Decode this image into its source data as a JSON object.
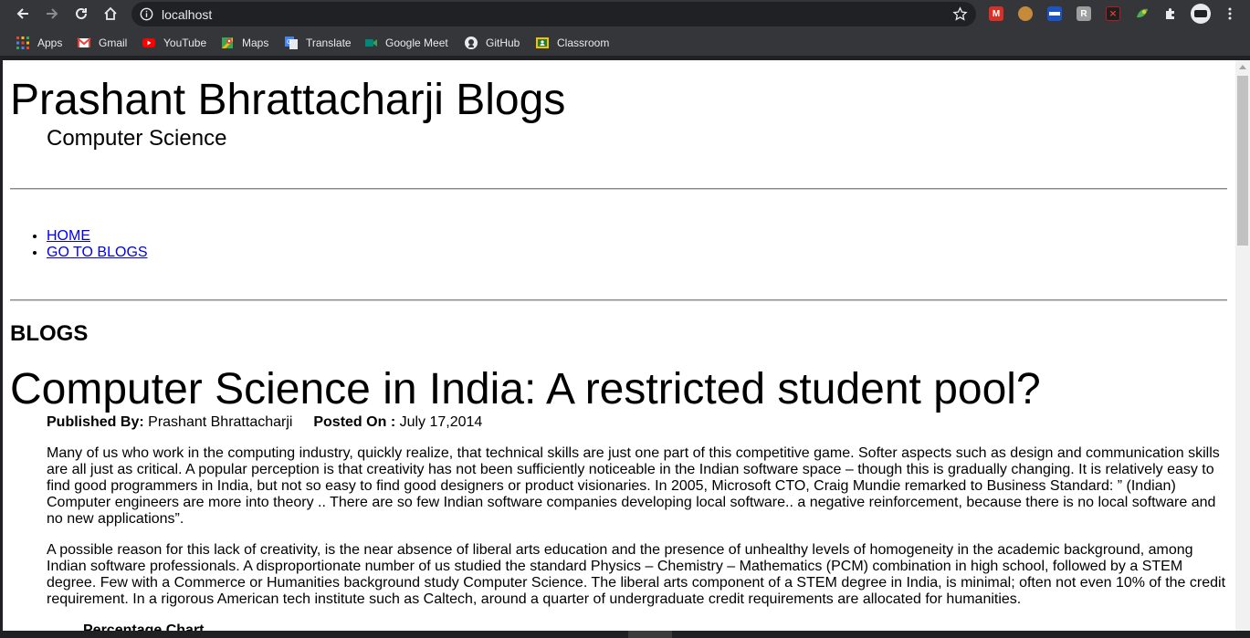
{
  "browser": {
    "url": "localhost",
    "bookmarks": [
      {
        "label": "Apps",
        "icon": "apps-grid-icon"
      },
      {
        "label": "Gmail",
        "icon": "gmail-icon"
      },
      {
        "label": "YouTube",
        "icon": "youtube-icon"
      },
      {
        "label": "Maps",
        "icon": "maps-icon"
      },
      {
        "label": "Translate",
        "icon": "translate-icon"
      },
      {
        "label": "Google Meet",
        "icon": "meet-icon"
      },
      {
        "label": "GitHub",
        "icon": "github-icon"
      },
      {
        "label": "Classroom",
        "icon": "classroom-icon"
      }
    ],
    "extensions": [
      "m-icon",
      "cookie-icon",
      "flag-icon",
      "r-icon",
      "pdf-icon",
      "leaf-icon",
      "puzzle-icon",
      "profile-icon"
    ],
    "colors": {
      "chrome_bg": "#35363a",
      "omnibox_bg": "#202124",
      "text": "#e8eaed"
    }
  },
  "site": {
    "title": "Prashant Bhrattacharji Blogs",
    "tagline": "Computer Science"
  },
  "nav": {
    "home": "HOME",
    "blogs": "GO TO BLOGS"
  },
  "blogs": {
    "heading": "BLOGS",
    "post": {
      "title": "Computer Science in India: A restricted student pool?",
      "published_by_label": "Published By:",
      "author": "Prashant Bhrattacharji",
      "posted_on_label": "Posted On :",
      "date": "July 17,2014",
      "paragraphs": [
        "Many of us who work in the computing industry, quickly realize, that technical skills are just one part of this competitive game. Softer aspects such as design and communication skills are all just as critical. A popular perception is that creativity has not been sufficiently noticeable in the Indian software space – though this is gradually changing. It is relatively easy to find good programmers in India, but not so easy to find good designers or product visionaries. In 2005, Microsoft CTO, Craig Mundie remarked to Business Standard: ” (Indian) Computer engineers are more into theory .. There are so few Indian software companies developing local software.. a negative reinforcement, because there is no local software and no new applications”.",
        "A possible reason for this lack of creativity, is the near absence of liberal arts education and the presence of unhealthy levels of homogeneity in the academic background, among Indian software professionals. A disproportionate number of us studied the standard Physics – Chemistry – Mathematics (PCM) combination in high school, followed by a STEM degree. Few with a Commerce or Humanities background study Computer Science. The liberal arts component of a STEM degree in India, is minimal; often not even 10% of the credit requirement. In a rigorous American tech institute such as Caltech, around a quarter of undergraduate credit requirements are allocated for humanities."
      ],
      "chart_label": "Percentage Chart"
    }
  }
}
